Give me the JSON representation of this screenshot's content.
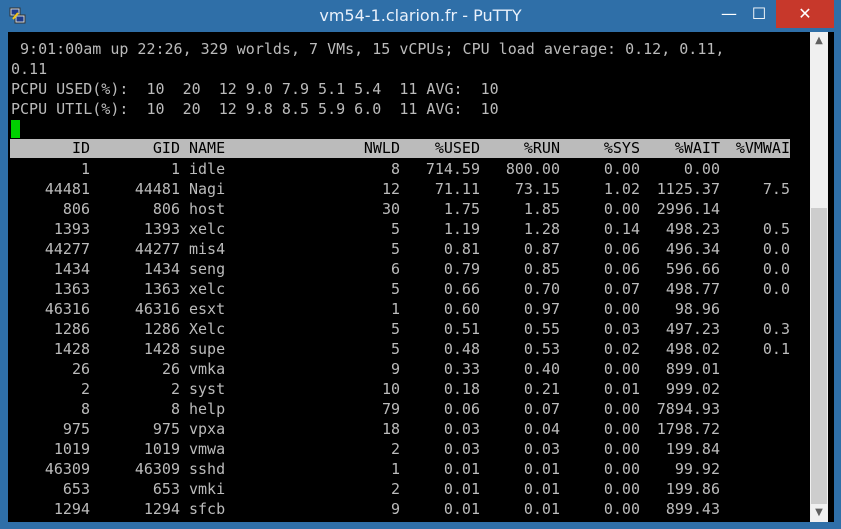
{
  "window": {
    "title": "vm54-1.clarion.fr - PuTTY",
    "minimize": "—",
    "maximize": "☐",
    "close": "✕"
  },
  "status": {
    "line1": " 9:01:00am up 22:26, 329 worlds, 7 VMs, 15 vCPUs; CPU load average: 0.12, 0.11,",
    "line2": "0.11",
    "line3": "PCPU USED(%):  10  20  12 9.0 7.9 5.1 5.4  11 AVG:  10",
    "line4": "PCPU UTIL(%):  10  20  12 9.8 8.5 5.9 6.0  11 AVG:  10"
  },
  "table": {
    "headers": [
      "ID",
      "GID",
      "NAME",
      "NWLD",
      "%USED",
      "%RUN",
      "%SYS",
      "%WAIT",
      "%VMWAI"
    ],
    "rows": [
      [
        "1",
        "1",
        "idle",
        "8",
        "714.59",
        "800.00",
        "0.00",
        "0.00",
        ""
      ],
      [
        "44481",
        "44481",
        "Nagi",
        "12",
        "71.11",
        "73.15",
        "1.02",
        "1125.37",
        "7.5"
      ],
      [
        "806",
        "806",
        "host",
        "30",
        "1.75",
        "1.85",
        "0.00",
        "2996.14",
        ""
      ],
      [
        "1393",
        "1393",
        "xelc",
        "5",
        "1.19",
        "1.28",
        "0.14",
        "498.23",
        "0.5"
      ],
      [
        "44277",
        "44277",
        "mis4",
        "5",
        "0.81",
        "0.87",
        "0.06",
        "496.34",
        "0.0"
      ],
      [
        "1434",
        "1434",
        "seng",
        "6",
        "0.79",
        "0.85",
        "0.06",
        "596.66",
        "0.0"
      ],
      [
        "1363",
        "1363",
        "xelc",
        "5",
        "0.66",
        "0.70",
        "0.07",
        "498.77",
        "0.0"
      ],
      [
        "46316",
        "46316",
        "esxt",
        "1",
        "0.60",
        "0.97",
        "0.00",
        "98.96",
        ""
      ],
      [
        "1286",
        "1286",
        "Xelc",
        "5",
        "0.51",
        "0.55",
        "0.03",
        "497.23",
        "0.3"
      ],
      [
        "1428",
        "1428",
        "supe",
        "5",
        "0.48",
        "0.53",
        "0.02",
        "498.02",
        "0.1"
      ],
      [
        "26",
        "26",
        "vmka",
        "9",
        "0.33",
        "0.40",
        "0.00",
        "899.01",
        ""
      ],
      [
        "2",
        "2",
        "syst",
        "10",
        "0.18",
        "0.21",
        "0.01",
        "999.02",
        ""
      ],
      [
        "8",
        "8",
        "help",
        "79",
        "0.06",
        "0.07",
        "0.00",
        "7894.93",
        ""
      ],
      [
        "975",
        "975",
        "vpxa",
        "18",
        "0.03",
        "0.04",
        "0.00",
        "1798.72",
        ""
      ],
      [
        "1019",
        "1019",
        "vmwa",
        "2",
        "0.03",
        "0.03",
        "0.00",
        "199.84",
        ""
      ],
      [
        "46309",
        "46309",
        "sshd",
        "1",
        "0.01",
        "0.01",
        "0.00",
        "99.92",
        ""
      ],
      [
        "653",
        "653",
        "vmki",
        "2",
        "0.01",
        "0.01",
        "0.00",
        "199.86",
        ""
      ],
      [
        "1294",
        "1294",
        "sfcb",
        "9",
        "0.01",
        "0.01",
        "0.00",
        "899.43",
        ""
      ]
    ]
  },
  "scrollbar": {
    "up_icon": "▲",
    "down_icon": "▼"
  },
  "colors": {
    "titlebar": "#2f6fa8",
    "close": "#c7382b",
    "terminal_bg": "#000000",
    "terminal_fg": "#bbbbbb",
    "cursor": "#00d000",
    "header_bg": "#bbbbbb"
  }
}
